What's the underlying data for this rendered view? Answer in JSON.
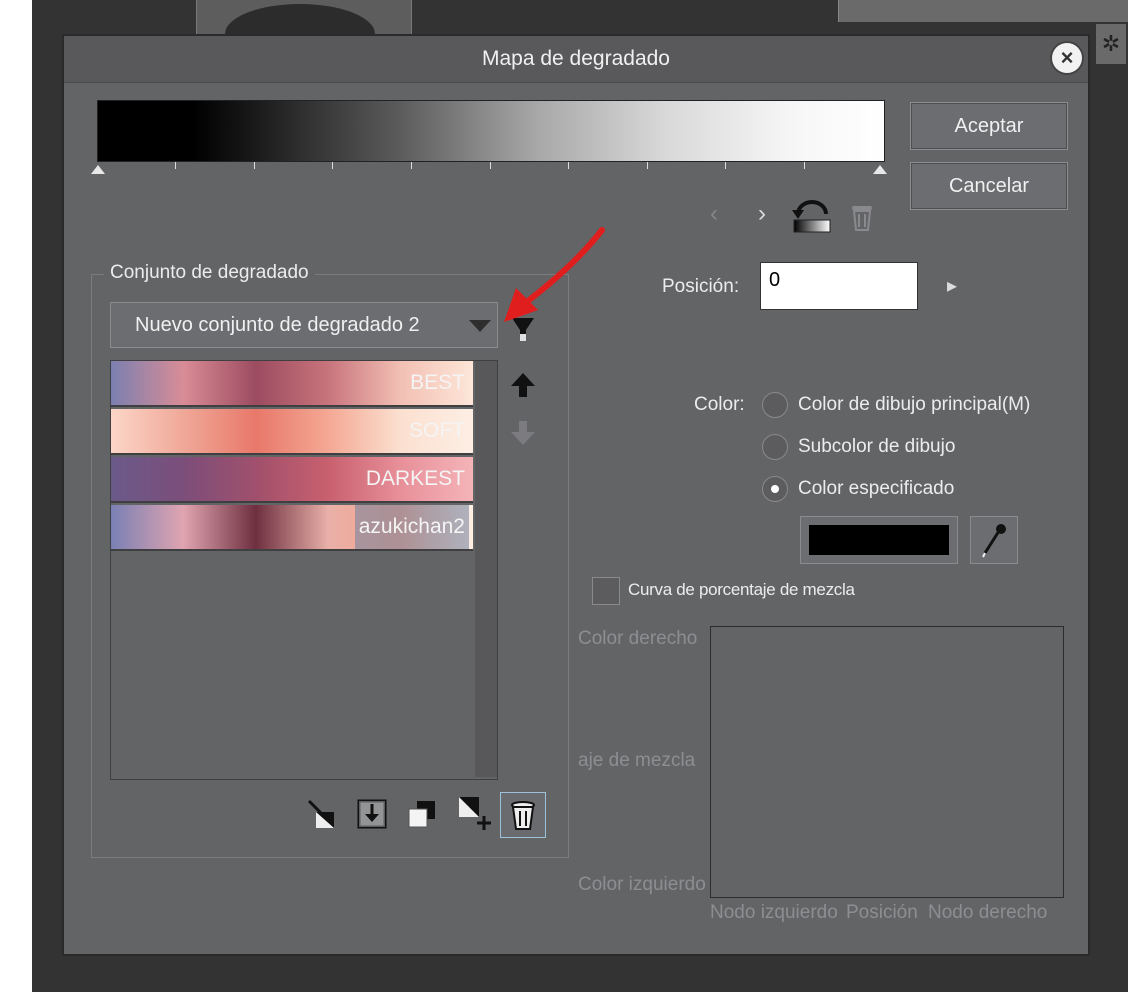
{
  "dialog": {
    "title": "Mapa de degradado",
    "accept_label": "Aceptar",
    "cancel_label": "Cancelar"
  },
  "gradient_set": {
    "group_title": "Conjunto de degradado",
    "selected_set": "Nuevo conjunto de degradado 2",
    "items": [
      {
        "label": "BEST",
        "colors": [
          "#7b80b0",
          "#d98c96",
          "#9c4c60",
          "#c8747c",
          "#f2c0b4",
          "#fde6d8"
        ]
      },
      {
        "label": "SOFT",
        "colors": [
          "#fcd6c8",
          "#f0a898",
          "#e8786a",
          "#f4a894",
          "#fbe0d0",
          "#fdeee4"
        ]
      },
      {
        "label": "DARKEST",
        "colors": [
          "#6a5a8a",
          "#7c4e7a",
          "#a0506c",
          "#c8606e",
          "#e8909a",
          "#f4b4b8"
        ]
      },
      {
        "label": "azukichan2",
        "colors": [
          "#7a80b4",
          "#e0a4b0",
          "#6e3040",
          "#e8b0a8",
          "#fca488",
          "#fef0e4"
        ]
      }
    ]
  },
  "position": {
    "label": "Posición:",
    "value": "0"
  },
  "color": {
    "label": "Color:",
    "options": [
      {
        "label": "Color de dibujo principal(M)",
        "selected": false
      },
      {
        "label": "Subcolor de dibujo",
        "selected": false
      },
      {
        "label": "Color especificado",
        "selected": true
      }
    ],
    "specified_color": "#000000"
  },
  "blend_curve": {
    "checkbox_label": "Curva de porcentaje de mezcla",
    "checked": false,
    "left_axis_top": "Color derecho",
    "left_axis_mid": "aje de mezcla",
    "left_axis_bottom": "Color izquierdo",
    "bottom_axis_left": "Nodo izquierdo",
    "bottom_axis_mid": "Posición",
    "bottom_axis_right": "Nodo derecho"
  }
}
